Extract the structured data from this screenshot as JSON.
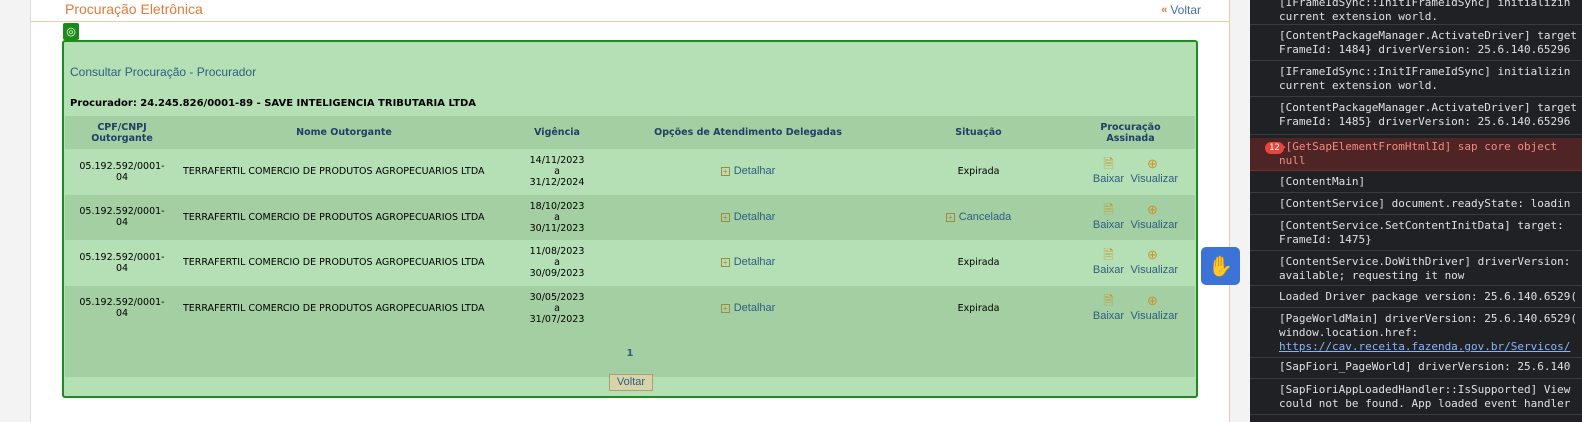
{
  "page": {
    "title": "Procuração Eletrônica",
    "back_link": "Voltar"
  },
  "panel": {
    "title": "Consultar Procuração - Procurador",
    "procurador": "Procurador: 24.245.826/0001-89 - SAVE INTELIGENCIA TRIBUTARIA LTDA",
    "headers": {
      "cpf_line1": "CPF/CNPJ",
      "cpf_line2": "Outorgante",
      "nome": "Nome Outorgante",
      "vigencia": "Vigência",
      "opcoes": "Opções de Atendimento Delegadas",
      "situacao": "Situação",
      "assinada_line1": "Procuração",
      "assinada_line2": "Assinada"
    },
    "rows": [
      {
        "cpf1": "05.192.592/0001-",
        "cpf2": "04",
        "nome": "TERRAFERTIL COMERCIO DE PRODUTOS AGROPECUARIOS LTDA",
        "inicio": "14/11/2023",
        "a": "a",
        "fim": "31/12/2024",
        "opcao": "Detalhar",
        "situacao": "Expirada",
        "baixar": "Baixar",
        "visualizar": "Visualizar"
      },
      {
        "cpf1": "05.192.592/0001-",
        "cpf2": "04",
        "nome": "TERRAFERTIL COMERCIO DE PRODUTOS AGROPECUARIOS LTDA",
        "inicio": "18/10/2023",
        "a": "a",
        "fim": "30/11/2023",
        "opcao": "Detalhar",
        "situacao": "Cancelada",
        "baixar": "Baixar",
        "visualizar": "Visualizar"
      },
      {
        "cpf1": "05.192.592/0001-",
        "cpf2": "04",
        "nome": "TERRAFERTIL COMERCIO DE PRODUTOS AGROPECUARIOS LTDA",
        "inicio": "11/08/2023",
        "a": "a",
        "fim": "30/09/2023",
        "opcao": "Detalhar",
        "situacao": "Expirada",
        "baixar": "Baixar",
        "visualizar": "Visualizar"
      },
      {
        "cpf1": "05.192.592/0001-",
        "cpf2": "04",
        "nome": "TERRAFERTIL COMERCIO DE PRODUTOS AGROPECUARIOS LTDA",
        "inicio": "30/05/2023",
        "a": "a",
        "fim": "31/07/2023",
        "opcao": "Detalhar",
        "situacao": "Expirada",
        "baixar": "Baixar",
        "visualizar": "Visualizar"
      }
    ],
    "pager": "1",
    "back_button": "Voltar"
  },
  "console": {
    "lines": [
      {
        "l1": "[IFrameIdSync::InitIFrameIdSync] initializin",
        "l2": "current extension world."
      },
      {
        "l1": "[ContentPackageManager.ActivateDriver] target",
        "l2": "FrameId: 1484} driverVersion: 25.6.140.65296"
      },
      {
        "l1": "[IFrameIdSync::InitIFrameIdSync] initializin",
        "l2": "current extension world."
      },
      {
        "l1": "[ContentPackageManager.ActivateDriver] target",
        "l2": "FrameId: 1485} driverVersion: 25.6.140.65296"
      },
      {
        "badge": "12",
        "l1": "▶[GetSapElementFromHtmlId] sap core object",
        "l2": "null"
      },
      {
        "l1": "[ContentMain]"
      },
      {
        "l1": "[ContentService] document.readyState: loadin"
      },
      {
        "l1": "[ContentService.SetContentInitData] target: ",
        "l2": "FrameId: 1475}"
      },
      {
        "l1": "[ContentService.DoWithDriver] driverVersion: ",
        "l2": "available; requesting it now"
      },
      {
        "l1": "Loaded Driver package version: 25.6.140.6529("
      },
      {
        "l1": "[PageWorldMain] driverVersion: 25.6.140.6529(",
        "l2": "window.location.href:",
        "link": "https://cav.receita.fazenda.gov.br/Servicos/"
      },
      {
        "l1": "[SapFiori_PageWorld] driverVersion: 25.6.140"
      },
      {
        "l1": "[SapFioriAppLoadedHandler::IsSupported] View",
        "l2": "could not be found. App loaded event handler"
      }
    ]
  },
  "colors": {
    "panel_bg": "#b5dfb5",
    "panel_border": "#1c8c1c",
    "title_orange": "#e07b3a",
    "link_blue": "#2f5d82",
    "devtools_bg": "#202124",
    "error_bg": "#4e2424"
  },
  "icons": {
    "back": "double-left-arrow-icon",
    "target": "target-icon",
    "detail": "plus-box-icon",
    "download": "document-download-icon",
    "view": "magnifier-icon",
    "libras": "hands-sign-language-icon"
  }
}
